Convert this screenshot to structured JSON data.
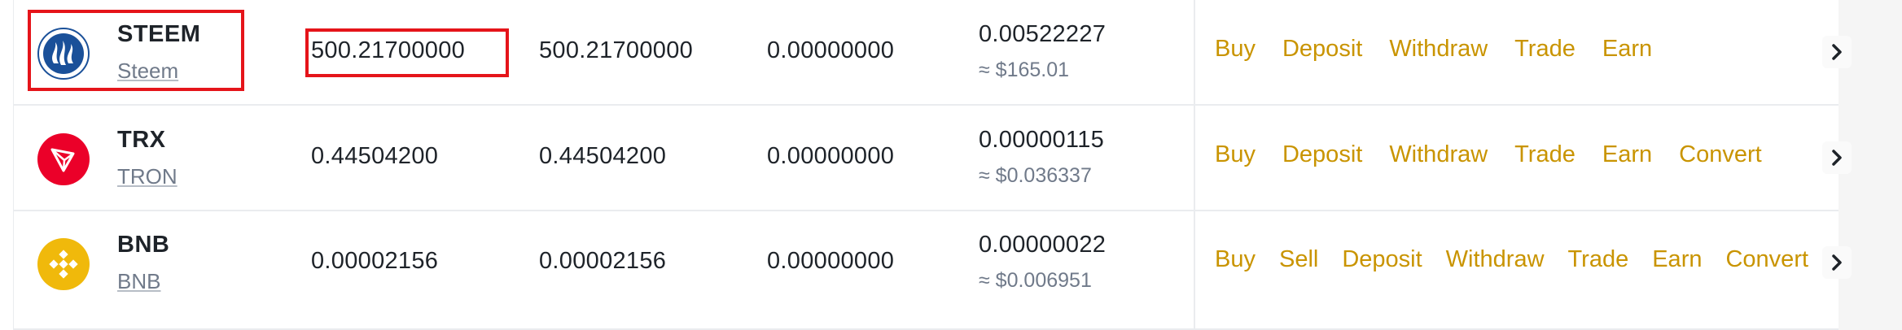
{
  "colors": {
    "action_link": "#c99400",
    "highlight": "#e5141a",
    "steem_icon": "#1a5099",
    "trx_icon": "#eb0029",
    "bnb_icon": "#f0b90b"
  },
  "rows": [
    {
      "symbol": "STEEM",
      "name": "Steem",
      "icon": "steem-icon",
      "total": "500.21700000",
      "available": "500.21700000",
      "in_order": "0.00000000",
      "btc_value": "0.00522227",
      "usd_value": "≈ $165.01",
      "actions": [
        "Buy",
        "Deposit",
        "Withdraw",
        "Trade",
        "Earn"
      ]
    },
    {
      "symbol": "TRX",
      "name": "TRON",
      "icon": "tron-icon",
      "total": "0.44504200",
      "available": "0.44504200",
      "in_order": "0.00000000",
      "btc_value": "0.00000115",
      "usd_value": "≈ $0.036337",
      "actions": [
        "Buy",
        "Deposit",
        "Withdraw",
        "Trade",
        "Earn",
        "Convert"
      ]
    },
    {
      "symbol": "BNB",
      "name": "BNB",
      "icon": "bnb-icon",
      "total": "0.00002156",
      "available": "0.00002156",
      "in_order": "0.00000000",
      "btc_value": "0.00000022",
      "usd_value": "≈ $0.006951",
      "actions": [
        "Buy",
        "Sell",
        "Deposit",
        "Withdraw",
        "Trade",
        "Earn",
        "Convert"
      ]
    }
  ]
}
